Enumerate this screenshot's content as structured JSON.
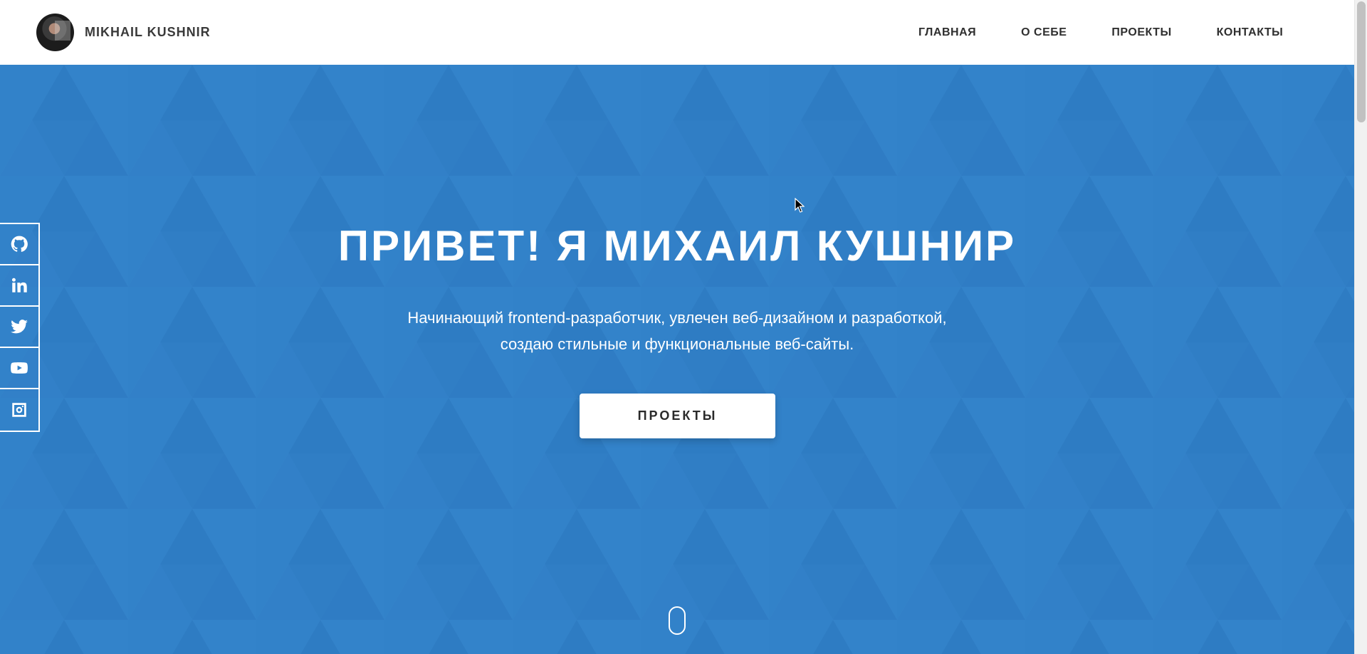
{
  "brand": {
    "name": "MIKHAIL KUSHNIR",
    "avatar_icon": "avatar-photo"
  },
  "nav": {
    "items": [
      {
        "label": "ГЛАВНАЯ"
      },
      {
        "label": "О СЕБЕ"
      },
      {
        "label": "ПРОЕКТЫ"
      },
      {
        "label": "КОНТАКТЫ"
      }
    ]
  },
  "hero": {
    "title": "ПРИВЕТ! Я МИХАИЛ КУШНИР",
    "text_line1": "Начинающий frontend-разработчик, увлечен веб-дизайном и разработкой,",
    "text_line2": "создаю стильные и функциональные веб-сайты.",
    "button_label": "ПРОЕКТЫ",
    "background_color": "#3181c8",
    "scroll_indicator_icon": "mouse-scroll-icon"
  },
  "social": {
    "items": [
      {
        "icon": "github-icon"
      },
      {
        "icon": "linkedin-icon"
      },
      {
        "icon": "twitter-icon"
      },
      {
        "icon": "youtube-icon"
      },
      {
        "icon": "instagram-icon"
      }
    ]
  },
  "colors": {
    "accent": "#3181c8",
    "text_dark": "#2f2f2f",
    "white": "#ffffff"
  }
}
